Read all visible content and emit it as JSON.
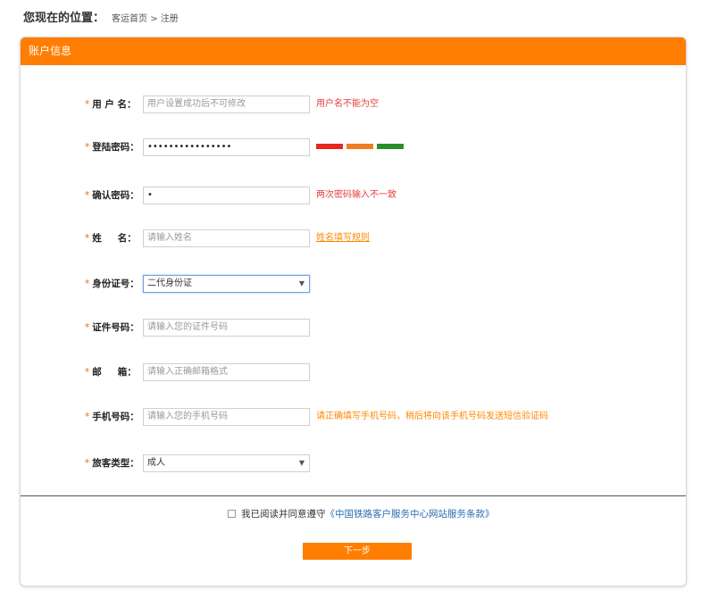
{
  "breadcrumb": {
    "title": "您现在的位置：",
    "path": "客运首页 > 注册"
  },
  "panel": {
    "header": "账户信息"
  },
  "form": {
    "username": {
      "label": "用 户 名：",
      "placeholder": "用户设置成功后不可修改",
      "error": "用户名不能为空"
    },
    "password": {
      "label": "登陆密码：",
      "value": "••••••••••••••••",
      "strength_colors": [
        "#e8261c",
        "#ef7d22",
        "#2a8f2a"
      ]
    },
    "confirm": {
      "label": "确认密码：",
      "value": "•",
      "error": "两次密码输入不一致"
    },
    "name": {
      "label_a": "姓",
      "label_b": "名：",
      "placeholder": "请输入姓名",
      "rule_link": "姓名填写规则"
    },
    "id_type": {
      "label": "身份证号：",
      "selected": "二代身份证"
    },
    "id_number": {
      "label": "证件号码：",
      "placeholder": "请输入您的证件号码"
    },
    "email": {
      "label_a": "邮",
      "label_b": "箱：",
      "placeholder": "请输入正确邮箱格式"
    },
    "phone": {
      "label": "手机号码：",
      "placeholder": "请输入您的手机号码",
      "hint": "请正确填写手机号码，稍后将向该手机号码发送短信验证码"
    },
    "passenger_type": {
      "label": "旅客类型：",
      "selected": "成人"
    },
    "required_mark": "*"
  },
  "agreement": {
    "text": "我已阅读并同意遵守",
    "terms": "《中国铁路客户服务中心网站服务条款》"
  },
  "next_button": "下一步"
}
